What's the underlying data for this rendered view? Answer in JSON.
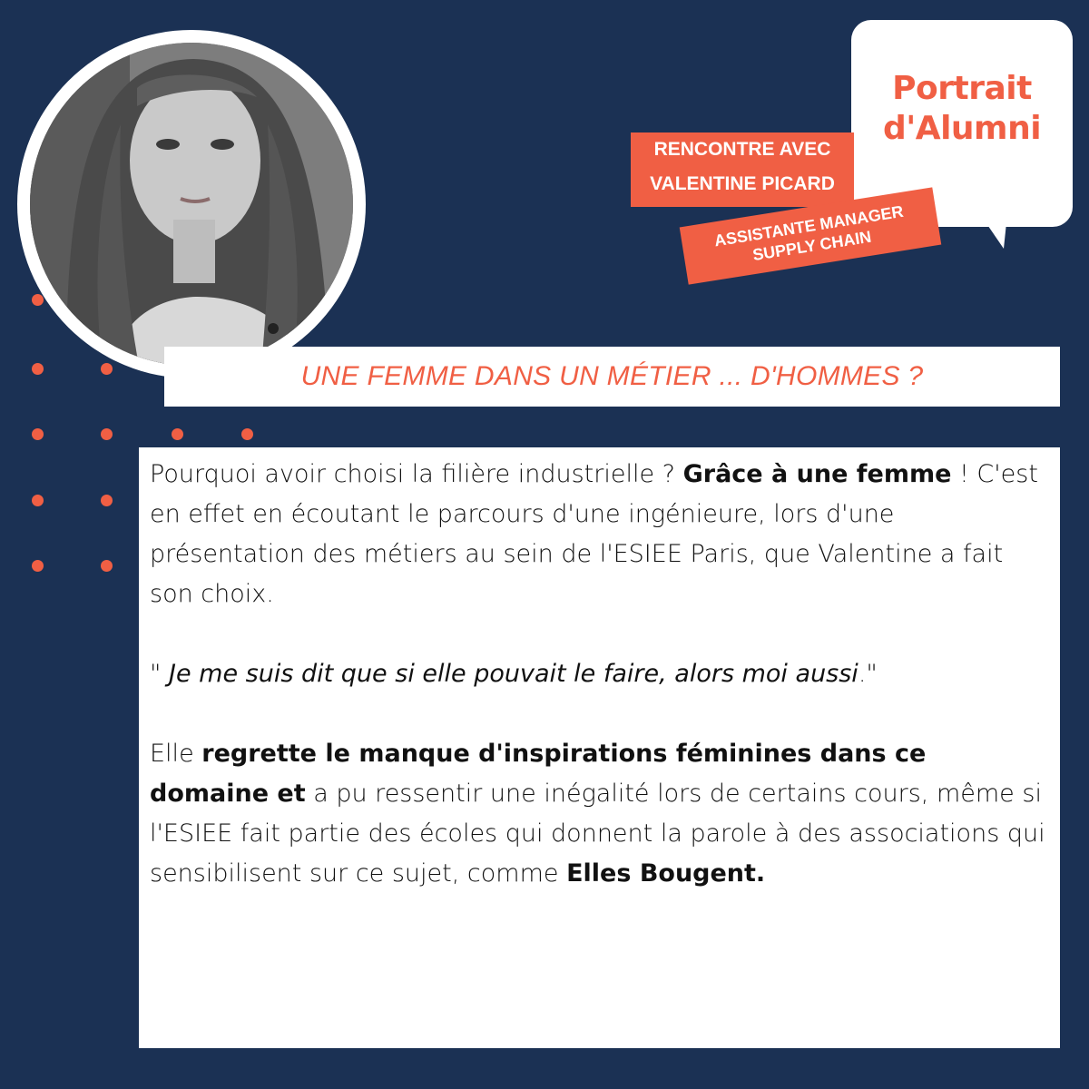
{
  "colors": {
    "background": "#1b3154",
    "accent": "#f05f44",
    "panel": "#ffffff",
    "text": "#111111"
  },
  "photo": {
    "icon": "portrait-photo"
  },
  "bubble": {
    "line1": "Portrait",
    "line2": "d'Alumni"
  },
  "tags": {
    "meet_line1": "RENCONTRE AVEC",
    "meet_line2": "VALENTINE PICARD",
    "job_line1": "ASSISTANTE MANAGER",
    "job_line2": "SUPPLY CHAIN"
  },
  "headline": "UNE FEMME DANS UN MÉTIER ... D'HOMMES ?",
  "body": {
    "p1_a": "Pourquoi avoir choisi la filière industrielle ? ",
    "p1_b": "Grâce à une femme",
    "p1_c": " ! C'est en effet en écoutant le parcours d'une ingénieure, lors d'une présentation des métiers au sein de l'ESIEE Paris, que Valentine a fait son choix.",
    "quote_open": "\" ",
    "quote_text": "Je me suis dit que si elle pouvait le faire, alors moi aussi",
    "quote_close": ".\"",
    "p3_a": "Elle ",
    "p3_b": "regrette le manque d'inspirations féminines dans ce domaine et",
    "p3_c": " a pu ressentir une inégalité lors de certains cours, même si l'ESIEE fait partie des écoles qui donnent la parole à des associations qui sensibilisent sur ce sujet, comme ",
    "p3_d": "Elles Bougent."
  }
}
